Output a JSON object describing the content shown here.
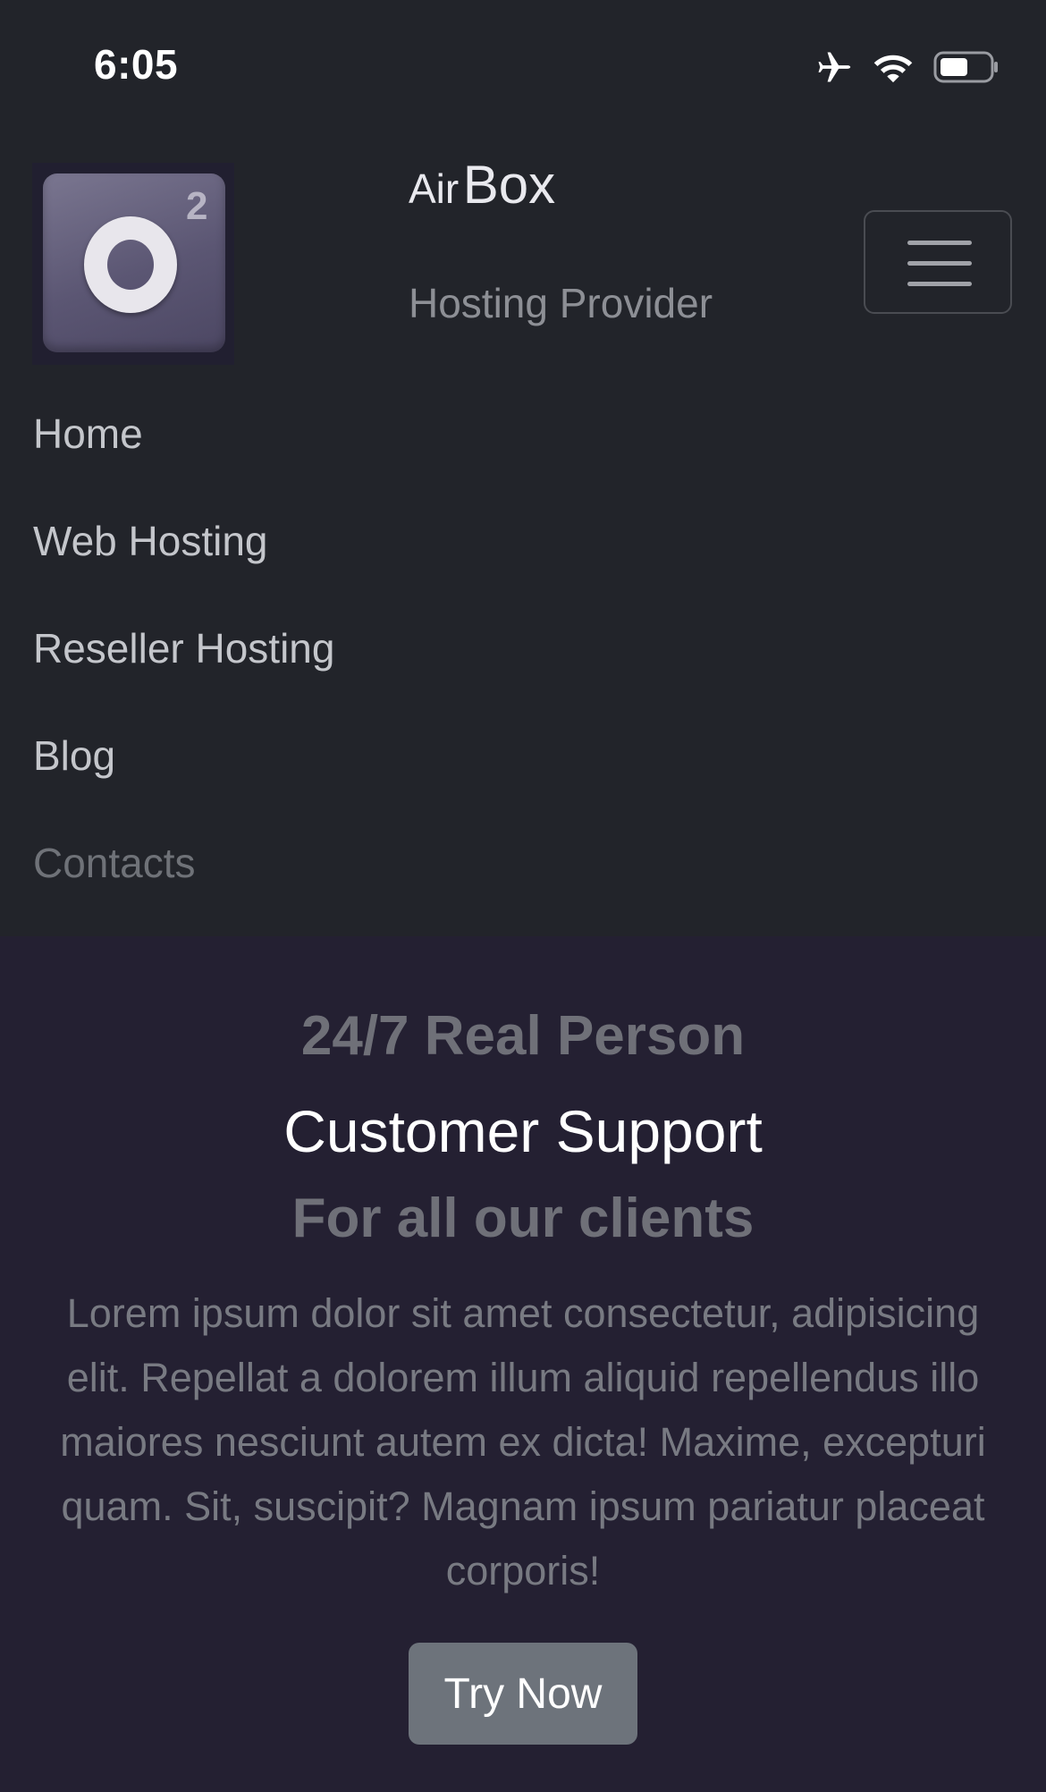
{
  "status_bar": {
    "time": "6:05",
    "icons": [
      "airplane-icon",
      "wifi-icon",
      "battery-icon"
    ]
  },
  "header": {
    "logo": {
      "letter": "O",
      "superscript": "2"
    },
    "brand_small": "Air",
    "brand_large": "Box",
    "subtitle": "Hosting Provider"
  },
  "nav": {
    "items": [
      {
        "label": "Home"
      },
      {
        "label": "Web Hosting"
      },
      {
        "label": "Reseller Hosting"
      },
      {
        "label": "Blog"
      },
      {
        "label": "Contacts"
      }
    ]
  },
  "hero": {
    "line1": "24/7 Real Person",
    "line2": "Customer Support",
    "line3": "For all our clients",
    "lead": "Lorem ipsum dolor sit amet consectetur, adipisicing elit. Repellat a dolorem illum aliquid repellendus illo maiores nesciunt autem ex dicta! Maxime, excepturi quam. Sit, suscipit? Magnam ipsum pariatur placeat corporis!",
    "button_label": "Try Now"
  },
  "colors": {
    "navbar_bg": "#22242a",
    "hero_bg": "#242032",
    "button_bg": "#6d737b"
  }
}
